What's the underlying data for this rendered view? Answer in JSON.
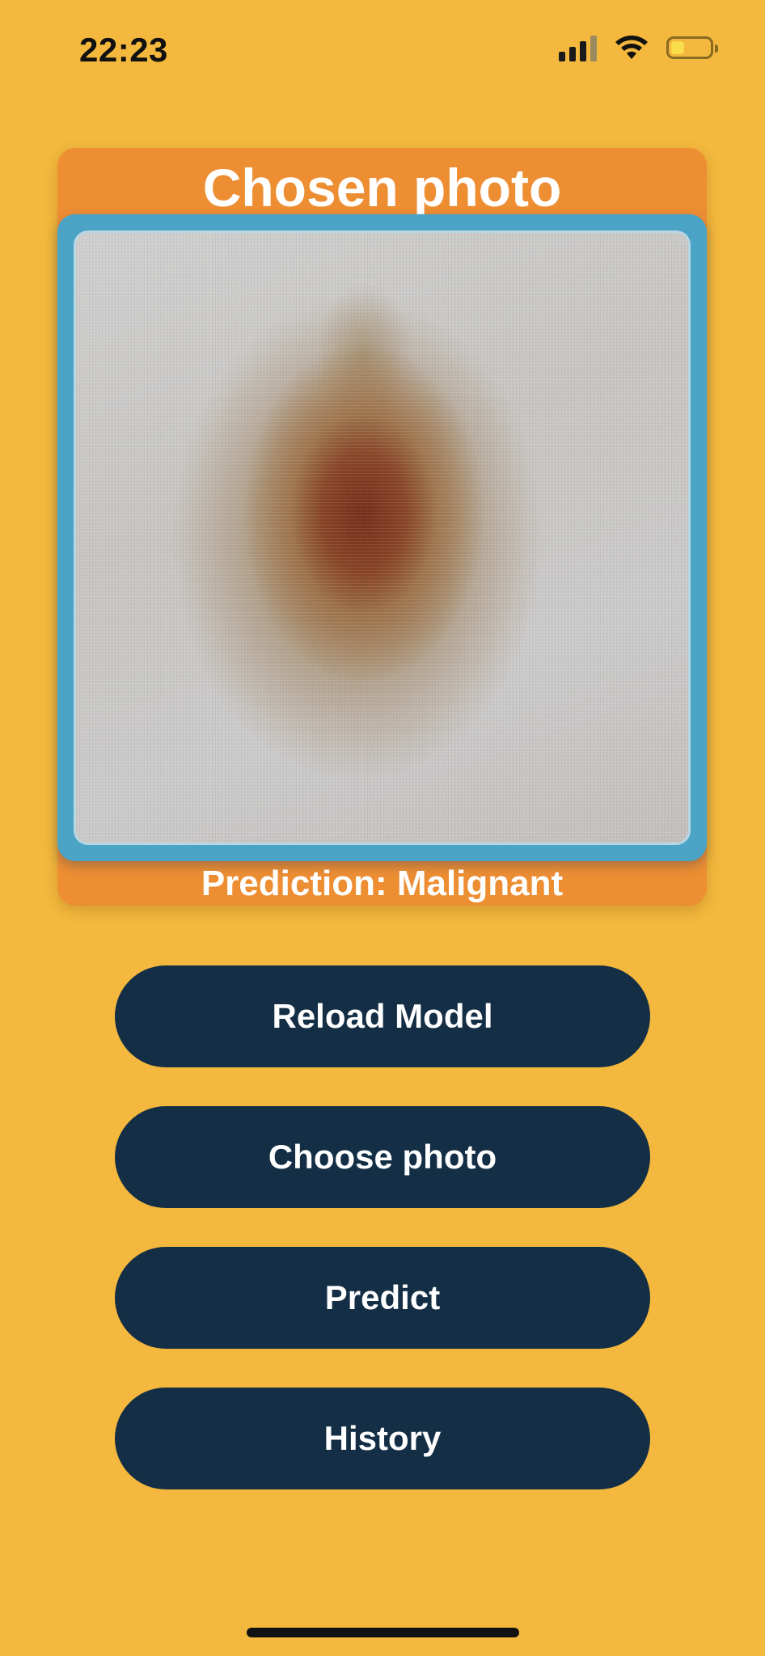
{
  "status_bar": {
    "time": "22:23",
    "icons": [
      "signal-icon",
      "wifi-icon",
      "battery-icon"
    ],
    "battery_level": 0.35
  },
  "card": {
    "title": "Chosen photo",
    "photo_content": "skin lesion dermoscopy image",
    "prediction": "Prediction: Malignant"
  },
  "buttons": {
    "reload_model": "Reload Model",
    "choose_photo": "Choose photo",
    "predict": "Predict",
    "history": "History"
  },
  "colors": {
    "background": "#F3B83D",
    "card_orange": "#EE8E33",
    "photo_frame_blue": "#4BA3C5",
    "button_navy": "#132E45",
    "text_white": "#FFFFFF"
  }
}
